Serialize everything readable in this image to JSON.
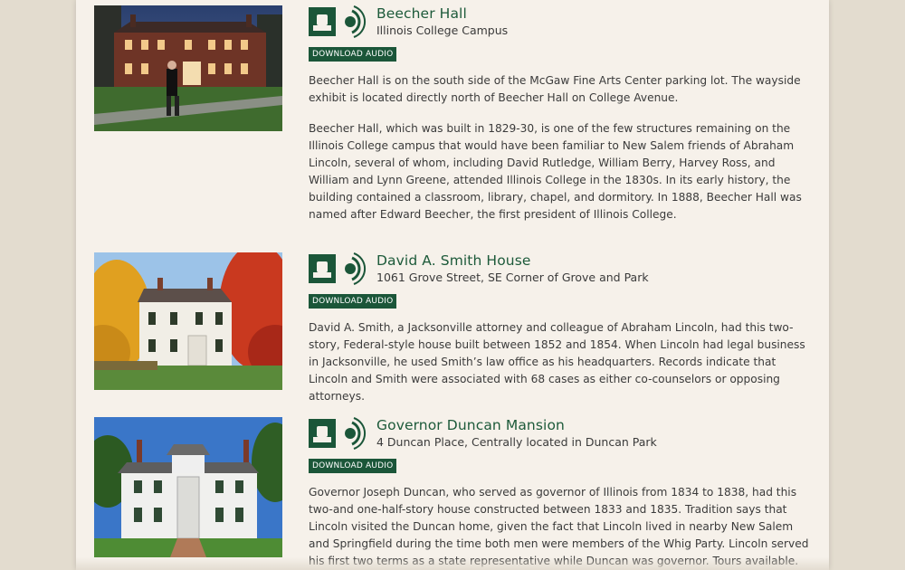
{
  "entries": [
    {
      "title": "Beecher Hall",
      "subtitle": "Illinois College Campus",
      "button": "DOWNLOAD AUDIO",
      "photo": "photo of Beecher Hall at dusk with costumed performer",
      "icons": [
        "landmark-building-icon",
        "audio-waves-icon"
      ],
      "paragraphs": [
        "Beecher Hall is on the south side of the McGaw Fine Arts Center parking lot. The wayside exhibit is located directly north of Beecher Hall on College Avenue.",
        "Beecher Hall, which was built in 1829-30, is one of the few structures remaining on the Illinois College campus that would have been familiar to New Salem friends of Abraham Lincoln, several of whom, including David Rutledge, William Berry, Harvey Ross, and William and Lynn Greene, attended Illinois College in the 1830s. In its early history, the building contained a classroom, library, chapel, and dormitory. In 1888, Beecher Hall was named after Edward Beecher, the first president of Illinois College."
      ]
    },
    {
      "title": "David A. Smith House",
      "subtitle": "1061 Grove Street, SE Corner of Grove and Park",
      "button": "DOWNLOAD AUDIO",
      "photo": "photo of David A. Smith House with autumn trees",
      "icons": [
        "landmark-building-icon",
        "audio-waves-icon"
      ],
      "paragraphs": [
        "David A. Smith, a Jacksonville attorney and colleague of Abraham Lincoln, had this two-story, Federal-style house built between 1852 and 1854. When Lincoln had legal business in Jacksonville, he used Smith’s law office as his headquarters. Records indicate that Lincoln and Smith were associated with 68 cases as either co-counselors or opposing attorneys."
      ]
    },
    {
      "title": "Governor Duncan Mansion",
      "subtitle": "4 Duncan Place, Centrally located in Duncan Park",
      "button": "DOWNLOAD AUDIO",
      "photo": "photo of Governor Duncan Mansion",
      "icons": [
        "landmark-building-icon",
        "audio-waves-icon"
      ],
      "paragraphs": [
        "Governor Joseph Duncan, who served as governor of Illinois from 1834 to 1838, had this two-and one-half-story house constructed between 1833 and 1835. Tradition says that Lincoln visited the Duncan home, given the fact that Lincoln lived in nearby New Salem and Springfield during the time both men were members of the Whig Party. Lincoln served his first two terms as a state representative while Duncan was governor. Tours available."
      ]
    }
  ],
  "colors": {
    "accent": "#1b5639",
    "title": "#1d5a3a",
    "panel": "#f6f1ea",
    "background": "#e6dfd2"
  }
}
